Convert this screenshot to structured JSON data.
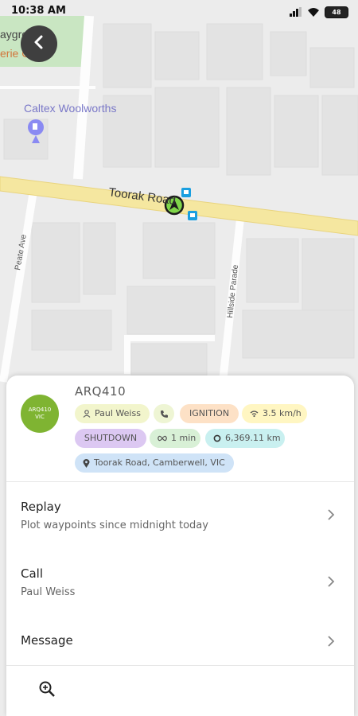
{
  "status_bar": {
    "time": "10:38 AM",
    "battery": "48"
  },
  "map": {
    "labels": {
      "playground": "ayground",
      "gate": "erie Gate",
      "station": "Caltex Woolworths",
      "road_main": "Toorak Road",
      "road_left": "Peate Ave",
      "road_mid": "Hillside Parade"
    }
  },
  "vehicle": {
    "avatar_line1": "ARQ410",
    "avatar_line2": "VIC",
    "id": "ARQ410",
    "chips": {
      "driver": "Paul Weiss",
      "ignition": "IGNITION",
      "speed": "3.5 km/h",
      "shutdown": "SHUTDOWN",
      "duration": "1 min",
      "odometer": "6,369.11 km",
      "location": "Toorak Road, Camberwell, VIC"
    }
  },
  "actions": {
    "replay_title": "Replay",
    "replay_sub": "Plot waypoints since midnight today",
    "call_title": "Call",
    "call_sub": "Paul Weiss",
    "message_title": "Message"
  },
  "colors": {
    "ignition": "#fde1c6",
    "shutdown": "#dcc8f2",
    "speed": "#fff6c2",
    "driver": "#f2f5cc",
    "phone": "#eef5d4",
    "duration": "#d8f0d6",
    "odometer": "#c9f0f0",
    "location": "#cfe3f7",
    "road": "#f5e7a0",
    "avatar": "#7fb432"
  }
}
